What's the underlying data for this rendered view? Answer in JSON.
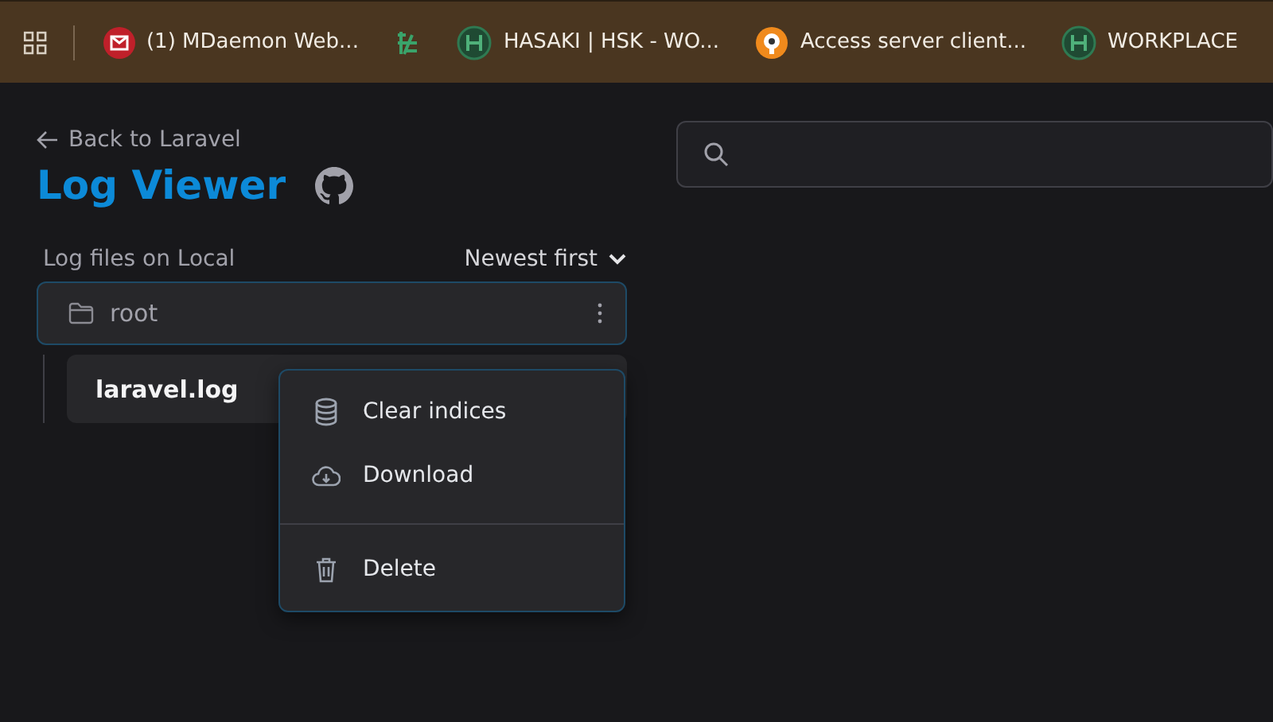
{
  "bookmarks": [
    {
      "label": "(1) MDaemon Web...",
      "kind": "mail"
    },
    {
      "kind": "sheet"
    },
    {
      "label": "HASAKI | HSK - WO...",
      "kind": "hub"
    },
    {
      "label": "Access server client...",
      "kind": "keyhole"
    },
    {
      "label": "WORKPLACE",
      "kind": "hub"
    }
  ],
  "back_link": "Back to Laravel",
  "title": "Log Viewer",
  "files_label": "Log files on Local",
  "sort": "Newest first",
  "folder": {
    "name": "root",
    "files": [
      {
        "name": "laravel.log"
      }
    ]
  },
  "menu_groups": [
    [
      {
        "label": "Clear indices",
        "kind": "database"
      },
      {
        "label": "Download",
        "kind": "download"
      }
    ],
    [
      {
        "label": "Delete",
        "kind": "delete"
      }
    ]
  ]
}
